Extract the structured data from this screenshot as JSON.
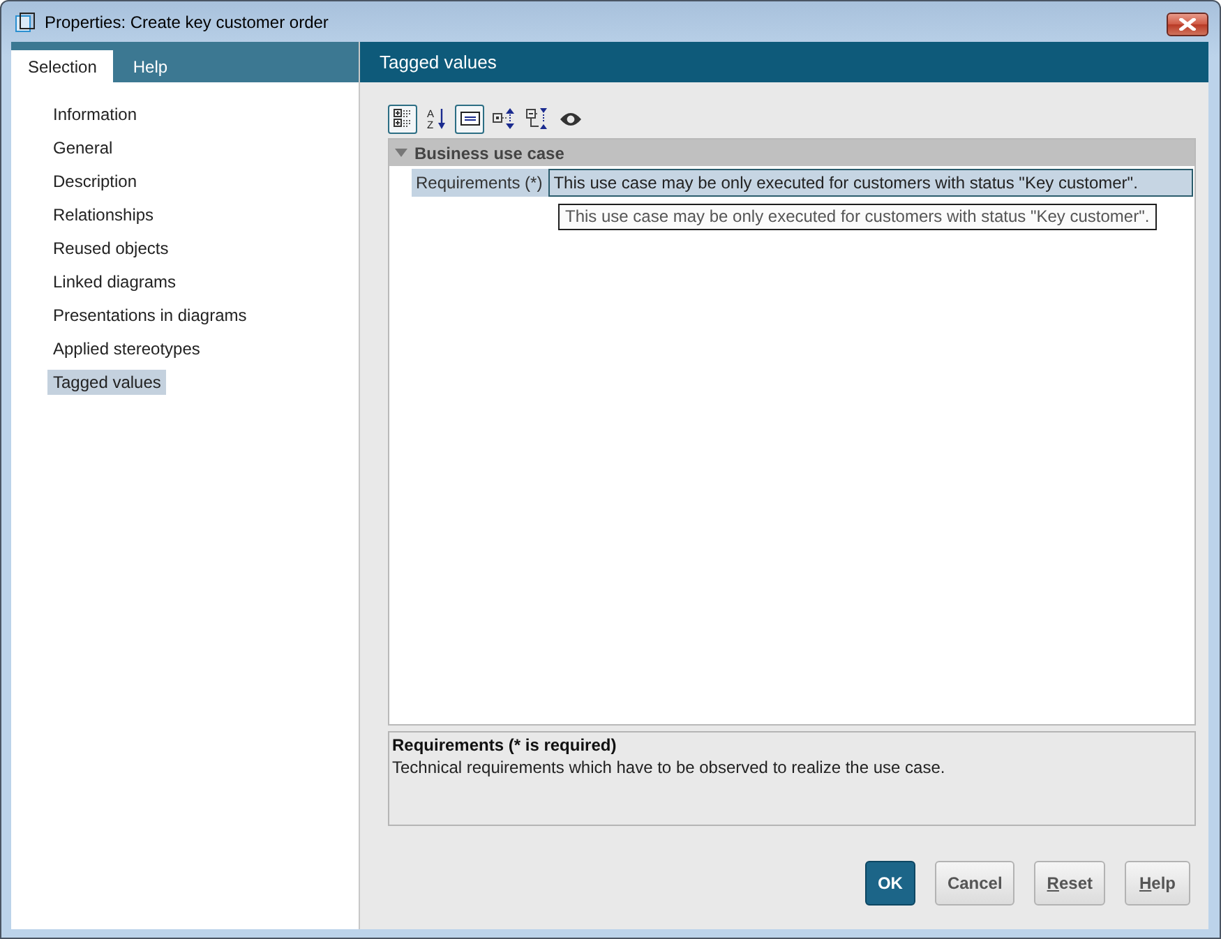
{
  "window": {
    "title": "Properties: Create key customer order"
  },
  "left_tabs": [
    {
      "label": "Selection",
      "selected": true
    },
    {
      "label": "Help",
      "selected": false
    }
  ],
  "sidebar": {
    "items": [
      {
        "label": "Information",
        "selected": false
      },
      {
        "label": "General",
        "selected": false
      },
      {
        "label": "Description",
        "selected": false
      },
      {
        "label": "Relationships",
        "selected": false
      },
      {
        "label": "Reused objects",
        "selected": false
      },
      {
        "label": "Linked diagrams",
        "selected": false
      },
      {
        "label": "Presentations in diagrams",
        "selected": false
      },
      {
        "label": "Applied stereotypes",
        "selected": false
      },
      {
        "label": "Tagged values",
        "selected": true
      }
    ]
  },
  "panel": {
    "title": "Tagged values"
  },
  "toolbar": [
    {
      "kind": "categorized",
      "selected": true
    },
    {
      "kind": "sort",
      "selected": false,
      "letters": [
        "A",
        "Z"
      ]
    },
    {
      "kind": "description",
      "selected": true
    },
    {
      "kind": "expand_all",
      "selected": false
    },
    {
      "kind": "collapse_all",
      "selected": false
    },
    {
      "kind": "eye",
      "selected": false
    }
  ],
  "property_grid": {
    "categories": [
      {
        "name": "Business use case",
        "expanded": true,
        "properties": [
          {
            "label": "Requirements (*)",
            "value": "This use case may be only executed for customers with status \"Key customer\".",
            "selected": true
          }
        ]
      }
    ],
    "tooltip": "This use case may be only executed for customers with status \"Key customer\"."
  },
  "description": {
    "title": "Requirements (* is required)",
    "text": "Technical requirements which have to be observed to realize the use case."
  },
  "buttons": [
    {
      "label": "OK",
      "kind": "default",
      "mnemonic": false
    },
    {
      "label": "Cancel",
      "kind": "normal",
      "mnemonic": false
    },
    {
      "label": "Reset",
      "kind": "normal",
      "mnemonic": true
    },
    {
      "label": "Help",
      "kind": "normal",
      "mnemonic": true
    }
  ]
}
